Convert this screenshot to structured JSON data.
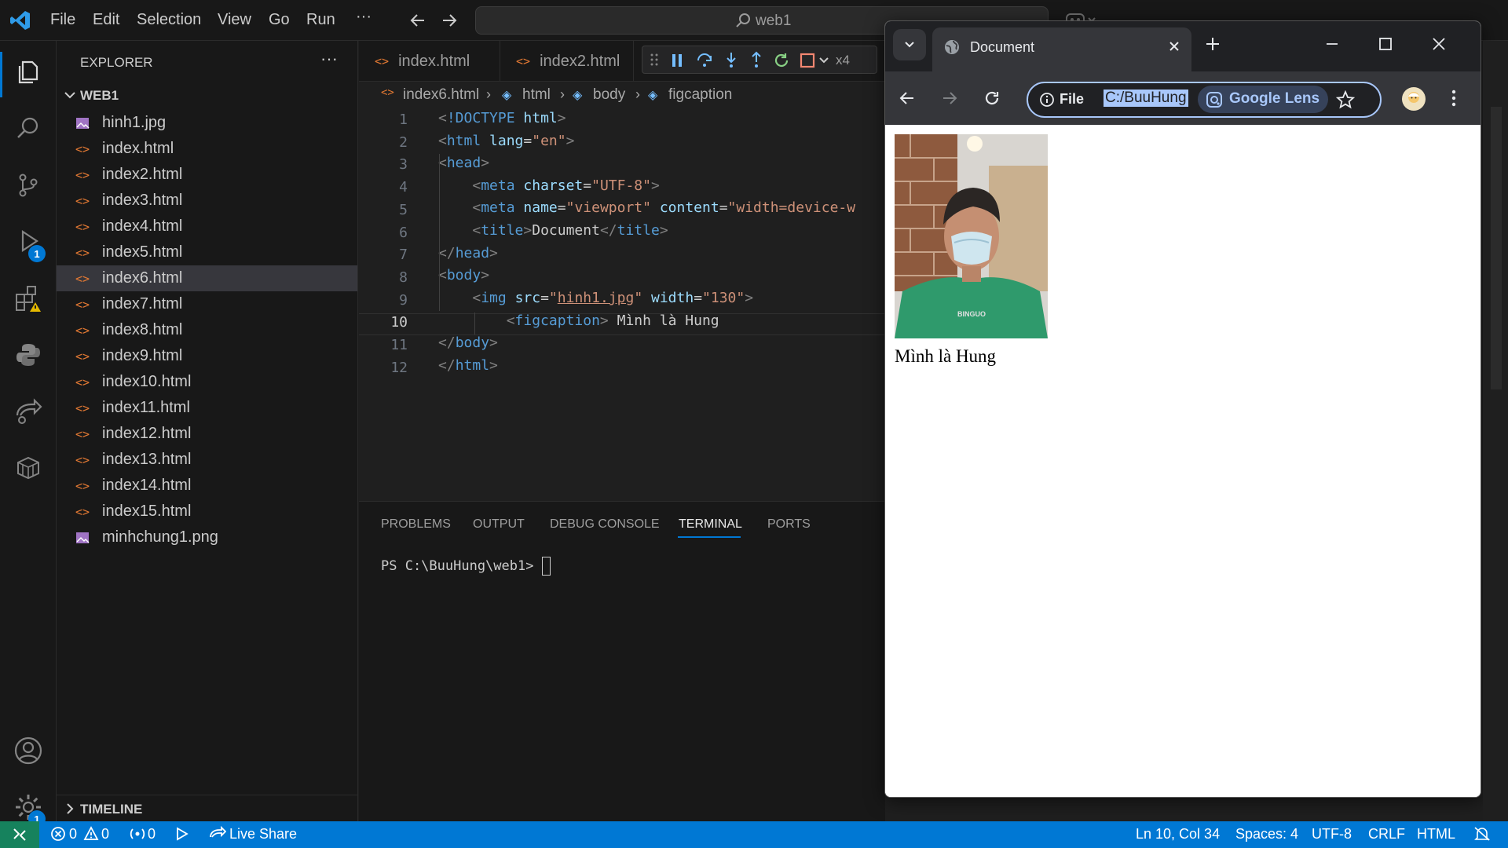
{
  "menu": [
    "File",
    "Edit",
    "Selection",
    "View",
    "Go",
    "Run",
    "···"
  ],
  "search": {
    "text": "web1"
  },
  "explorer": {
    "title": "EXPLORER",
    "folder": "WEB1",
    "files": [
      {
        "name": "hinh1.jpg",
        "type": "image"
      },
      {
        "name": "index.html",
        "type": "html"
      },
      {
        "name": "index2.html",
        "type": "html"
      },
      {
        "name": "index3.html",
        "type": "html"
      },
      {
        "name": "index4.html",
        "type": "html"
      },
      {
        "name": "index5.html",
        "type": "html"
      },
      {
        "name": "index6.html",
        "type": "html",
        "selected": true
      },
      {
        "name": "index7.html",
        "type": "html"
      },
      {
        "name": "index8.html",
        "type": "html"
      },
      {
        "name": "index9.html",
        "type": "html"
      },
      {
        "name": "index10.html",
        "type": "html"
      },
      {
        "name": "index11.html",
        "type": "html"
      },
      {
        "name": "index12.html",
        "type": "html"
      },
      {
        "name": "index13.html",
        "type": "html"
      },
      {
        "name": "index14.html",
        "type": "html"
      },
      {
        "name": "index15.html",
        "type": "html"
      },
      {
        "name": "minhchung1.png",
        "type": "image"
      }
    ],
    "timeline": "TIMELINE"
  },
  "activity_badges": {
    "debug": "1",
    "settings": "1"
  },
  "tabs": [
    "index.html",
    "index2.html"
  ],
  "debug_overflow": "x4",
  "breadcrumb": [
    "index6.html",
    "html",
    "body",
    "figcaption"
  ],
  "code": {
    "line_numbers": [
      "1",
      "2",
      "3",
      "4",
      "5",
      "6",
      "7",
      "8",
      "9",
      "10",
      "11",
      "12"
    ],
    "current_line": "10"
  },
  "panel": {
    "tabs": [
      "PROBLEMS",
      "OUTPUT",
      "DEBUG CONSOLE",
      "TERMINAL",
      "PORTS"
    ],
    "active": "TERMINAL",
    "prompt": "PS C:\\BuuHung\\web1> "
  },
  "status": {
    "errors": "0",
    "warnings": "0",
    "ports": "0",
    "live_share": "Live Share",
    "position": "Ln 10, Col 34",
    "spaces": "Spaces: 4",
    "encoding": "UTF-8",
    "eol": "CRLF",
    "language": "HTML"
  },
  "browser": {
    "tab_title": "Document",
    "file_chip": "File",
    "address": "C:/BuuHung",
    "lens": "Google Lens",
    "caption": "Mình là Hung"
  },
  "colors": {
    "accent": "#0078d4",
    "tag": "#569cd6",
    "attr": "#9cdcfe",
    "string": "#ce9178",
    "html_icon": "#e37933"
  }
}
